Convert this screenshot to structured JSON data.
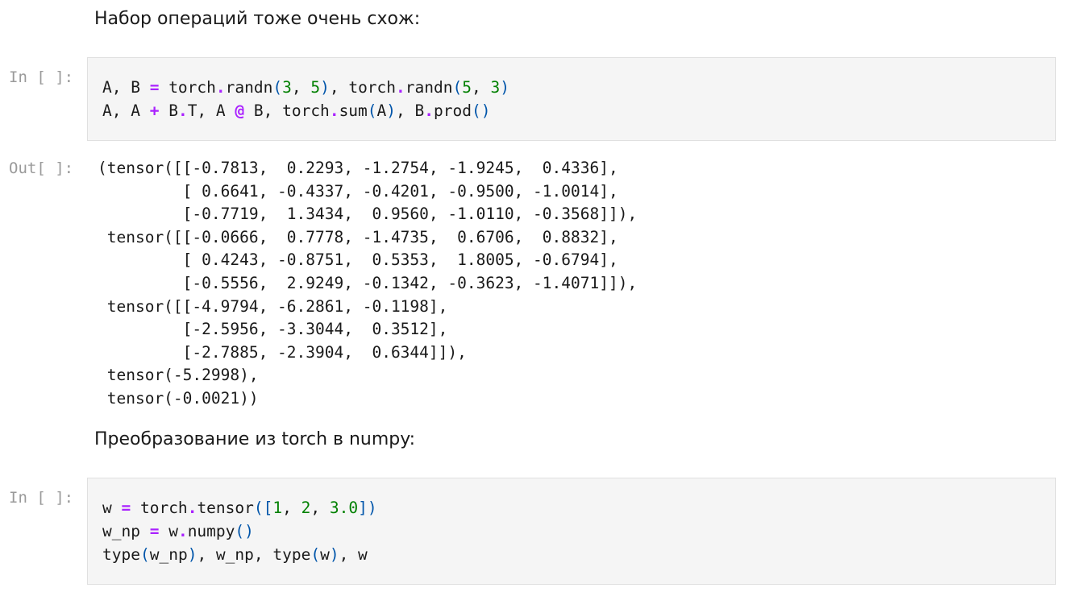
{
  "markdown": {
    "text1": "Набор операций тоже очень схож:",
    "text2": "Преобразование из torch в numpy:"
  },
  "cells": {
    "cell1": {
      "prompt": "In [ ]:",
      "tokens": {
        "l1_a": "A, B ",
        "l1_eq": "=",
        "l1_b": " torch",
        "l1_dot1": ".",
        "l1_c": "randn",
        "l1_p1": "(",
        "l1_n1": "3",
        "l1_comma1": ", ",
        "l1_n2": "5",
        "l1_p2": ")",
        "l1_d": ", torch",
        "l1_dot2": ".",
        "l1_e": "randn",
        "l1_p3": "(",
        "l1_n3": "5",
        "l1_comma2": ", ",
        "l1_n4": "3",
        "l1_p4": ")",
        "l2_a": "A, A ",
        "l2_plus": "+",
        "l2_b": " B",
        "l2_dot1": ".",
        "l2_c": "T, A ",
        "l2_at": "@",
        "l2_d": " B, torch",
        "l2_dot2": ".",
        "l2_e": "sum",
        "l2_p1": "(",
        "l2_f": "A",
        "l2_p2": ")",
        "l2_g": ", B",
        "l2_dot3": ".",
        "l2_h": "prod",
        "l2_p3": "()"
      }
    },
    "out1": {
      "prompt": "Out[ ]:",
      "lines": [
        "(tensor([[-0.7813,  0.2293, -1.2754, -1.9245,  0.4336],",
        "         [ 0.6641, -0.4337, -0.4201, -0.9500, -1.0014],",
        "         [-0.7719,  1.3434,  0.9560, -1.0110, -0.3568]]),",
        " tensor([[-0.0666,  0.7778, -1.4735,  0.6706,  0.8832],",
        "         [ 0.4243, -0.8751,  0.5353,  1.8005, -0.6794],",
        "         [-0.5556,  2.9249, -0.1342, -0.3623, -1.4071]]),",
        " tensor([[-4.9794, -6.2861, -0.1198],",
        "         [-2.5956, -3.3044,  0.3512],",
        "         [-2.7885, -2.3904,  0.6344]]),",
        " tensor(-5.2998),",
        " tensor(-0.0021))"
      ]
    },
    "cell2": {
      "prompt": "In [ ]:",
      "tokens": {
        "l1_a": "w ",
        "l1_eq": "=",
        "l1_b": " torch",
        "l1_dot": ".",
        "l1_c": "tensor",
        "l1_p1": "([",
        "l1_n1": "1",
        "l1_comma1": ", ",
        "l1_n2": "2",
        "l1_comma2": ", ",
        "l1_n3": "3.0",
        "l1_p2": "])",
        "l2_a": "w_np ",
        "l2_eq": "=",
        "l2_b": " w",
        "l2_dot": ".",
        "l2_c": "numpy",
        "l2_p": "()",
        "l3_a": "type",
        "l3_p1": "(",
        "l3_b": "w_np",
        "l3_p2": ")",
        "l3_c": ", w_np, type",
        "l3_p3": "(",
        "l3_d": "w",
        "l3_p4": ")",
        "l3_e": ", w"
      }
    }
  }
}
